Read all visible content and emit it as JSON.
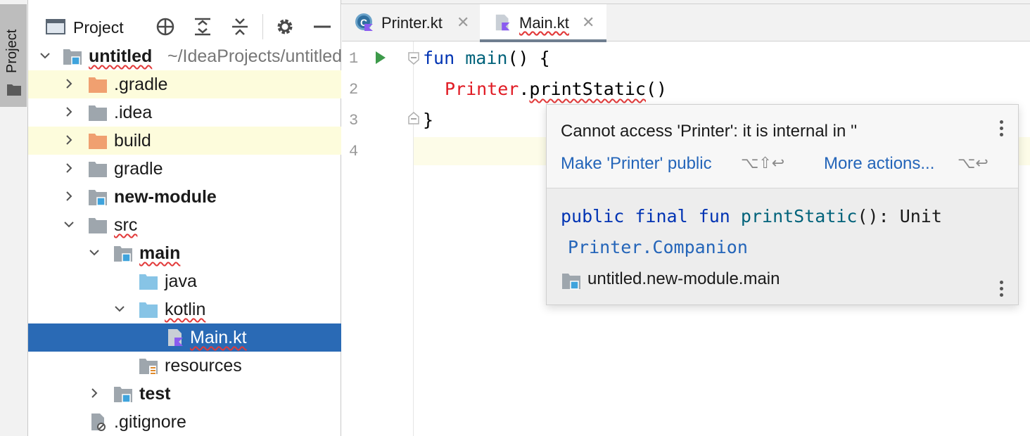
{
  "tool_stripe": {
    "label": "Project"
  },
  "project_panel": {
    "title": "Project",
    "tree": [
      {
        "label": "untitled",
        "path": "~/IdeaProjects/untitled",
        "bold": true
      },
      {
        "label": ".gradle"
      },
      {
        "label": ".idea"
      },
      {
        "label": "build"
      },
      {
        "label": "gradle"
      },
      {
        "label": "new-module",
        "bold": true
      },
      {
        "label": "src"
      },
      {
        "label": "main",
        "bold": true
      },
      {
        "label": "java"
      },
      {
        "label": "kotlin"
      },
      {
        "label": "Main.kt",
        "selected": true
      },
      {
        "label": "resources"
      },
      {
        "label": "test",
        "bold": true
      },
      {
        "label": ".gitignore"
      }
    ]
  },
  "editor": {
    "tabs": [
      {
        "label": "Printer.kt",
        "active": false
      },
      {
        "label": "Main.kt",
        "active": true
      }
    ],
    "line_numbers": [
      "1",
      "2",
      "3",
      "4"
    ],
    "code": {
      "line1_kw": "fun",
      "line1_fn": "main",
      "line1_rest": "() {",
      "line2_class": "Printer",
      "line2_dot": ".",
      "line2_method": "printStatic",
      "line2_rest": "()",
      "line3": "}"
    }
  },
  "popup": {
    "message": "Cannot access 'Printer': it is internal in ''",
    "fix_action": "Make 'Printer' public",
    "fix_shortcut": "⌥⇧↩",
    "more_actions": "More actions...",
    "more_shortcut": "⌥↩",
    "signature": {
      "mod1": "public",
      "mod2": "final",
      "kw": "fun",
      "name": "printStatic",
      "ret": "(): Unit"
    },
    "containing_class": "Printer.Companion",
    "module": "untitled.new-module.main"
  },
  "colors": {
    "selection": "#2a6ab5",
    "excluded_folder": "#f0a070",
    "source_folder": "#87c4e6",
    "keyword": "#0033b3",
    "link": "#2465b9",
    "error": "#e01b24"
  }
}
